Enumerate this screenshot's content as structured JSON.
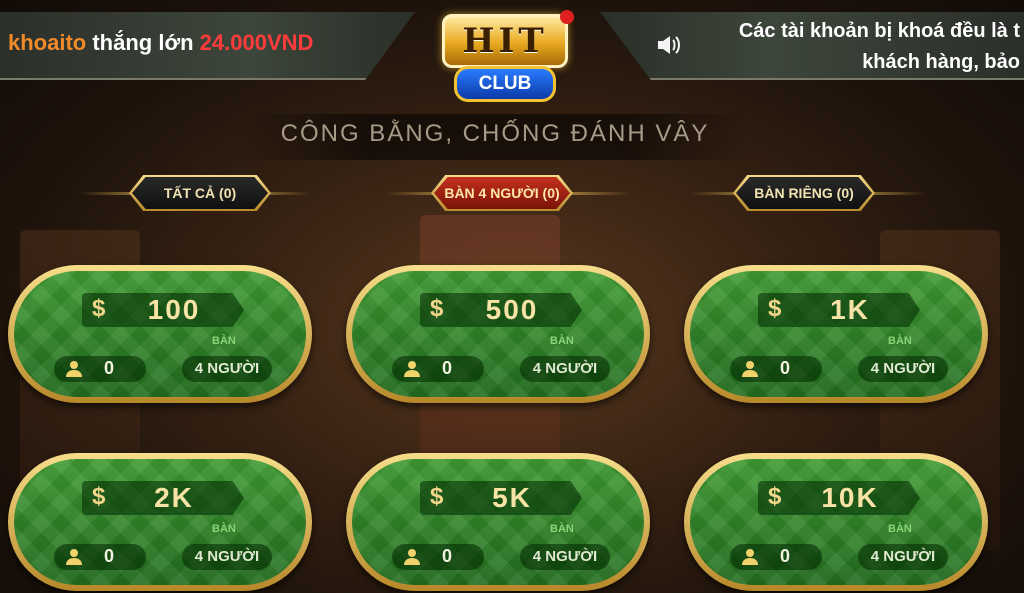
{
  "header": {
    "winner_user": "khoaito",
    "winner_text": "thắng lớn",
    "winner_amount": "24.000VND",
    "notice_line1": "Các tài khoản bị khoá đều là t",
    "notice_line2": "khách hàng, bảo",
    "speaker_icon": "speaker-icon",
    "logo_text": "HIT",
    "logo_sub": "CLUB"
  },
  "subtitle": "CÔNG BẰNG, CHỐNG ĐÁNH VÂY",
  "tabs": [
    {
      "label": "TẤT CẢ (0)",
      "active": false
    },
    {
      "label": "BÀN 4 NGƯỜI (0)",
      "active": true
    },
    {
      "label": "BÀN RIÊNG (0)",
      "active": false
    }
  ],
  "tables": [
    {
      "currency": "$",
      "bet": "100",
      "table_label": "BÀN",
      "players": "0",
      "seats": "4 NGƯỜI"
    },
    {
      "currency": "$",
      "bet": "500",
      "table_label": "BÀN",
      "players": "0",
      "seats": "4 NGƯỜI"
    },
    {
      "currency": "$",
      "bet": "1K",
      "table_label": "BÀN",
      "players": "0",
      "seats": "4 NGƯỜI"
    },
    {
      "currency": "$",
      "bet": "2K",
      "table_label": "BÀN",
      "players": "0",
      "seats": "4 NGƯỜI"
    },
    {
      "currency": "$",
      "bet": "5K",
      "table_label": "BÀN",
      "players": "0",
      "seats": "4 NGƯỜI"
    },
    {
      "currency": "$",
      "bet": "10K",
      "table_label": "BÀN",
      "players": "0",
      "seats": "4 NGƯỜI"
    }
  ],
  "colors": {
    "felt": "#2f8a2a",
    "gold": "#e6bd55",
    "active_tab": "#b02a1a",
    "winner_user": "#f08a2a",
    "winner_amount": "#ff3b3b"
  }
}
